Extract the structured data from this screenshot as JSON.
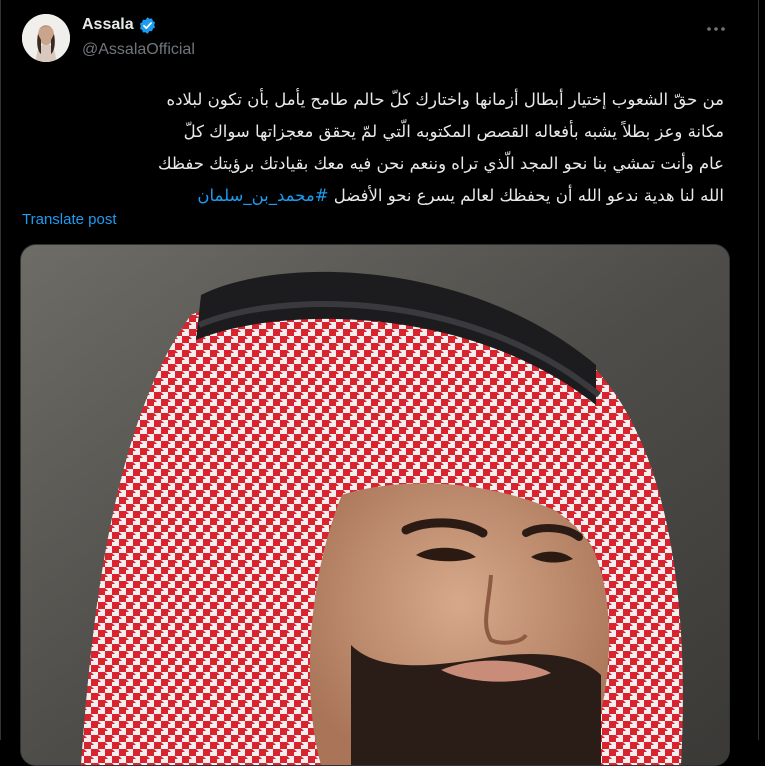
{
  "post": {
    "author": {
      "display_name": "Assala",
      "handle": "@AssalaOfficial",
      "verified": true,
      "avatar_icon": "avatar"
    },
    "more_icon": "more-options-icon",
    "text_line_1": "من حقّ الشعوب إختيار أبطال أزمانها واختارك كلّ حالم طامح يأمل بأن تكون لبلاده",
    "text_line_2": "مكانة وعز بطلاً يشبه بأفعاله القصص المكتوبه الّتي لمّ يحقق معجزاتها سواك كلّ",
    "text_line_3": "عام وأنت تمشي بنا نحو المجد الّذي تراه وننعم نحن فيه معك بقيادتك برؤيتك حفظك",
    "text_line_4": "الله لنا هدية ندعو الله أن يحفظك لعالم يسرع نحو الأفضل",
    "hashtag": "#محمد_بن_سلمان",
    "translate_label": "Translate post"
  },
  "colors": {
    "background": "#000000",
    "text": "#e7e9ea",
    "secondary": "#71767b",
    "accent": "#1d9bf0"
  }
}
